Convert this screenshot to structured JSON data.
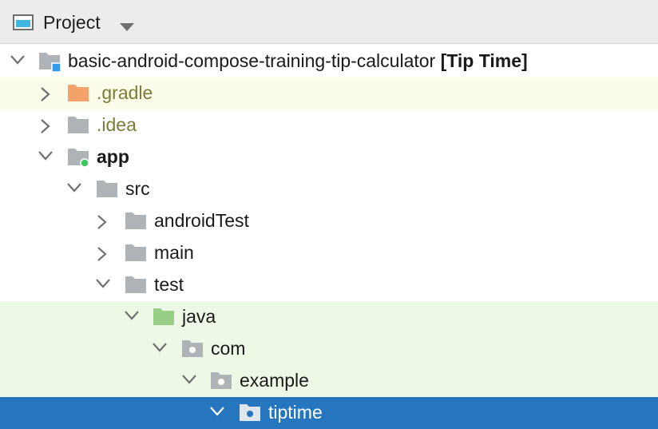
{
  "header": {
    "title": "Project",
    "window_icon": "project-window-icon",
    "dropdown_icon": "chevron-down-icon"
  },
  "colors": {
    "header_bg": "#ececec",
    "ignored_highlight": "#fcfcea",
    "test_highlight": "#eef8e6",
    "selection": "#2675bf",
    "folder_gray": "#aeb3b8",
    "folder_orange": "#f4a26a",
    "folder_green": "#98cf86",
    "module_dot": "#3fc55e",
    "root_badge": "#3598e8"
  },
  "tree": {
    "root": {
      "name": "basic-android-compose-training-tip-calculator",
      "tag": "[Tip Time]",
      "expanded": true
    },
    "gradle": {
      "name": ".gradle",
      "expanded": false
    },
    "idea": {
      "name": ".idea",
      "expanded": false
    },
    "app": {
      "name": "app",
      "expanded": true
    },
    "src": {
      "name": "src",
      "expanded": true
    },
    "android_test": {
      "name": "androidTest",
      "expanded": false
    },
    "main": {
      "name": "main",
      "expanded": false
    },
    "test": {
      "name": "test",
      "expanded": true
    },
    "java": {
      "name": "java",
      "expanded": true
    },
    "com": {
      "name": "com",
      "expanded": true
    },
    "example": {
      "name": "example",
      "expanded": true
    },
    "tiptime": {
      "name": "tiptime",
      "expanded": true,
      "selected": true
    }
  }
}
